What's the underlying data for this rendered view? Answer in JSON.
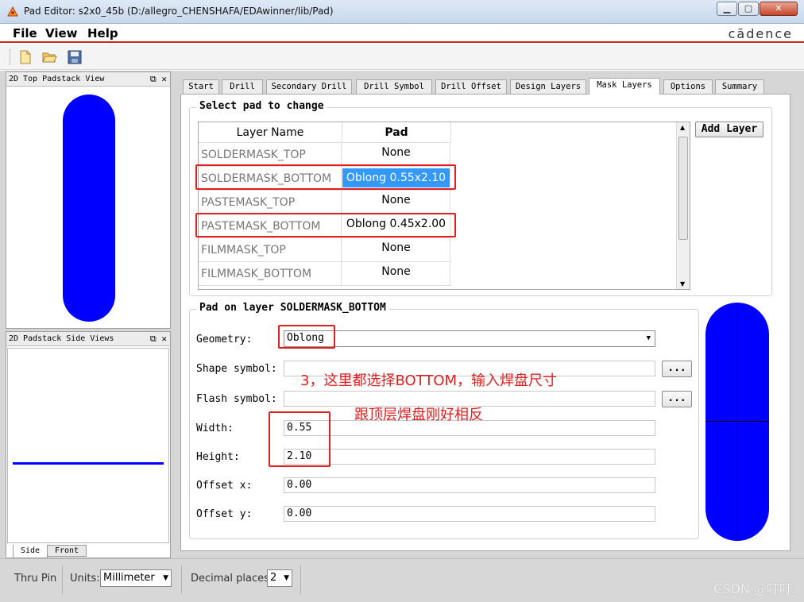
{
  "window": {
    "title": "Pad Editor: s2x0_45b  (D:/allegro_CHENSHAFA/EDAwinner/lib/Pad)",
    "min_btn": "▭",
    "max_btn": "▢",
    "close_btn": "✕"
  },
  "menu": {
    "file": "File",
    "view": "View",
    "help": "Help",
    "logo": "cādence"
  },
  "panels": {
    "top_view_title": "2D Top Padstack View",
    "side_view_title": "2D Padstack Side Views",
    "side_tab": "Side",
    "front_tab": "Front",
    "dock_btns": "⧉ ✕"
  },
  "tabs": [
    "Start",
    "Drill",
    "Secondary Drill",
    "Drill Symbol",
    "Drill Offset",
    "Design Layers",
    "Mask Layers",
    "Options",
    "Summary"
  ],
  "active_tab": "Mask Layers",
  "select_group": {
    "title": "Select pad to change",
    "col_layer": "Layer Name",
    "col_pad": "Pad",
    "add_layer": "Add Layer",
    "rows": [
      {
        "layer": "SOLDERMASK_TOP",
        "pad": "None"
      },
      {
        "layer": "SOLDERMASK_BOTTOM",
        "pad": "Oblong 0.55x2.10"
      },
      {
        "layer": "PASTEMASK_TOP",
        "pad": "None"
      },
      {
        "layer": "PASTEMASK_BOTTOM",
        "pad": "Oblong 0.45x2.00"
      },
      {
        "layer": "FILMMASK_TOP",
        "pad": "None"
      },
      {
        "layer": "FILMMASK_BOTTOM",
        "pad": "None"
      }
    ]
  },
  "pad_group": {
    "title": "Pad on layer SOLDERMASK_BOTTOM",
    "geometry_label": "Geometry:",
    "geometry_value": "Oblong",
    "shape_label": "Shape symbol:",
    "shape_value": "",
    "flash_label": "Flash symbol:",
    "flash_value": "",
    "browse": "...",
    "width_label": "Width:",
    "width_value": "0.55",
    "height_label": "Height:",
    "height_value": "2.10",
    "offx_label": "Offset x:",
    "offx_value": "0.00",
    "offy_label": "Offset y:",
    "offy_value": "0.00"
  },
  "annotations": {
    "line1": "3，这里都选择BOTTOM，输入焊盘尺寸",
    "line2": "跟顶层焊盘刚好相反"
  },
  "status": {
    "mode": "Thru Pin",
    "units_label": "Units:",
    "units_value": "Millimeter",
    "decimal_label": "Decimal places:",
    "decimal_value": "2",
    "watermark": "CSDN @叮叮."
  },
  "colors": {
    "pad_fill": "#0000ff",
    "highlight": "#e02020",
    "selection": "#3399ff"
  }
}
